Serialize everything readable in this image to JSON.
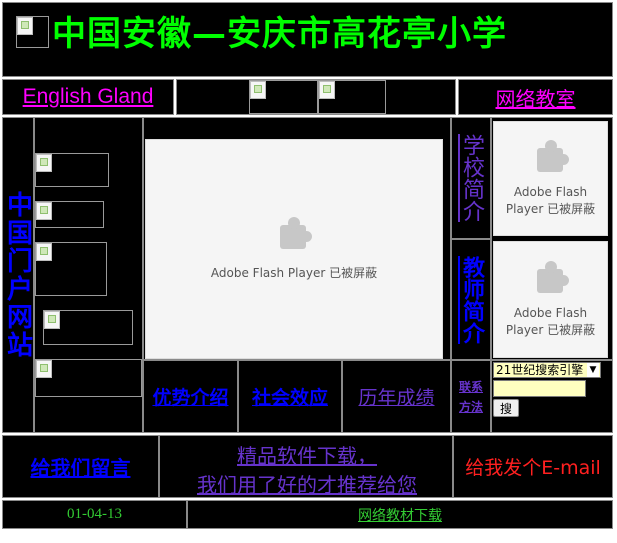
{
  "header": {
    "title": "中国安徽—安庆市高花亭小学"
  },
  "nav": {
    "english_link": "English Gland",
    "network_classroom": "网络教室"
  },
  "left_banner": {
    "text": "中国门户网站"
  },
  "flash": {
    "message_line1": "Adobe Flash",
    "message_line2": "Player 已被屏蔽",
    "message_full": "Adobe Flash Player 已被屏蔽"
  },
  "right_links": {
    "school_intro": "学校简介",
    "teacher_intro": "教师简介",
    "contact": "联系方法"
  },
  "middle_links": {
    "advantages": "优势介绍",
    "social_effect": "社会效应",
    "history": "历年成绩"
  },
  "search": {
    "engine": "21世纪搜索引擎",
    "value": "",
    "button": "搜"
  },
  "footer_row": {
    "guestbook": "给我们留言",
    "software_line1": "精品软件下载，",
    "software_line2": "我们用了好的才推荐给您",
    "email": "给我发个E-mail"
  },
  "bottom": {
    "date": "01-04-13",
    "materials": "网络教材下载"
  },
  "colors": {
    "background": "#000000",
    "title": "#00ff00",
    "pink": "#ff00ff",
    "blue": "#0000ff",
    "purple": "#6633cc",
    "red": "#ff2020",
    "green": "#33cc33"
  }
}
